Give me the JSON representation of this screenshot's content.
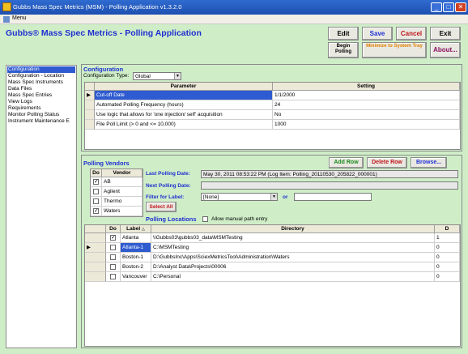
{
  "window": {
    "title": "Gubbs Mass Spec Metrics (MSM) - Polling Application   v1.3.2.0",
    "min_glyph": "_",
    "max_glyph": "□",
    "close_glyph": "✕"
  },
  "menu": {
    "label": "Menu"
  },
  "app_title": "Gubbs® Mass Spec Metrics - Polling Application",
  "toolbar": {
    "edit": "Edit",
    "save": "Save",
    "cancel": "Cancel",
    "exit": "Exit",
    "begin_polling": "Begin Polling",
    "minimize_tray": "Minimize to System Tray",
    "about": "About..."
  },
  "nav": {
    "items": [
      "Configuration",
      "Configuration - Location",
      "Mass Spec Instruments",
      "Data Files",
      "Mass Spec Entries",
      "View Logs",
      "Requirements",
      "Monitor Polling Status",
      "Instrument Maintenance E"
    ],
    "selected_index": 0
  },
  "configuration": {
    "section_title": "Configuration",
    "type_label": "Configuration Type:",
    "type_value": "Global",
    "columns": [
      "Parameter",
      "Setting"
    ],
    "rows": [
      {
        "parameter": "Cut-off Date",
        "setting": "1/1/2000"
      },
      {
        "parameter": "Automated Polling Frequency (hours)",
        "setting": "24"
      },
      {
        "parameter": "Use logic that allows for 'one injection/ self' acquisition",
        "setting": "No"
      },
      {
        "parameter": "File Poll Limit (> 0 and <= 10,000)",
        "setting": "1000"
      }
    ],
    "current_row_marker": "▶"
  },
  "polling_vendors": {
    "section_title": "Polling Vendors",
    "add_row": "Add Row",
    "delete_row": "Delete Row",
    "browse": "Browse...",
    "columns": [
      "Do",
      "Vendor"
    ],
    "vendors": [
      {
        "name": "AB",
        "checked": true
      },
      {
        "name": "Agilent",
        "checked": false
      },
      {
        "name": "Thermo",
        "checked": false
      },
      {
        "name": "Waters",
        "checked": true
      }
    ],
    "select_all": "Select All",
    "last_polling_label": "Last Polling Date:",
    "last_polling_value": "May 30, 2011  08:53:22 PM   (Log Item: Polling_20110530_205822_000001)",
    "next_polling_label": "Next Polling Date:",
    "next_polling_value": "",
    "filter_label": "Filter for Label:",
    "filter_value": "[None]",
    "or_label": "or",
    "filter_text": ""
  },
  "polling_locations": {
    "section_title": "Polling Locations",
    "manual_entry_label": "Allow manual path entry",
    "manual_entry_checked": false,
    "columns": [
      "Do",
      "Label",
      "Directory",
      "D"
    ],
    "sort_glyph": "△",
    "rows": [
      {
        "do": true,
        "label": "Atlanta",
        "directory": "\\\\Gubbs03\\gubbs03_data\\MSMTesting",
        "d": "1"
      },
      {
        "do": false,
        "label": "Atlanta-1",
        "directory": "C:\\MSMTesting",
        "d": "0"
      },
      {
        "do": false,
        "label": "Boston-1",
        "directory": "D:\\GubbsInc\\Apps\\SciexMetricsTool\\Administration\\Waters",
        "d": "0"
      },
      {
        "do": false,
        "label": "Boston-2",
        "directory": "D:\\Analyst Data\\Projects\\00006",
        "d": "0"
      },
      {
        "do": false,
        "label": "Vancouver",
        "directory": "C:\\Personal",
        "d": "0"
      }
    ],
    "current_row_marker": "▶"
  },
  "colors": {
    "accent": "#1f2fd0",
    "selection": "#2f5bd0",
    "danger": "#c0161d",
    "background": "#cfeec8"
  }
}
